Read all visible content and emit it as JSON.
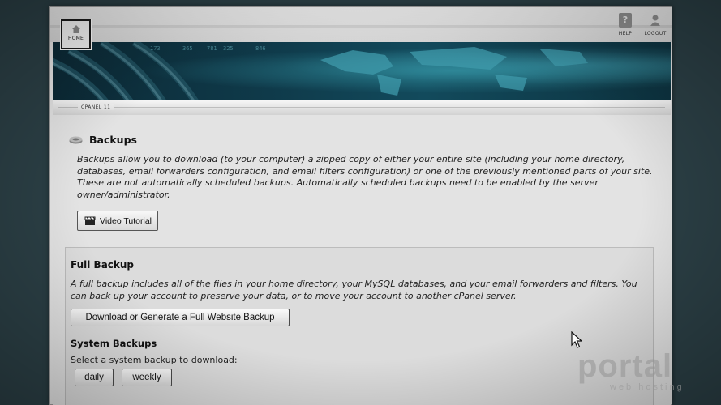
{
  "header": {
    "home_label": "HOME",
    "help_label": "HELP",
    "logout_label": "LOGOUT"
  },
  "breadcrumb": {
    "label": "CPANEL 11"
  },
  "page": {
    "title": "Backups",
    "intro": "Backups allow you to download (to your computer) a zipped copy of either your entire site (including your home directory, databases, email forwarders configuration, and email filters configuration) or one of the previously mentioned parts of your site. These are not automatically scheduled backups. Automatically scheduled backups need to be enabled by the server owner/administrator.",
    "video_button": "Video Tutorial"
  },
  "full_backup": {
    "title": "Full Backup",
    "description": "A full backup includes all of the files in your home directory, your MySQL databases, and your email forwarders and filters. You can back up your account to preserve your data, or to move your account to another cPanel server.",
    "button": "Download or Generate a Full Website Backup"
  },
  "system_backups": {
    "title": "System Backups",
    "select_label": "Select a system backup to download:",
    "buttons": [
      "daily",
      "weekly"
    ]
  },
  "watermark": {
    "brand": "portal",
    "tagline": "web hosting"
  },
  "icons": {
    "home": "home-icon",
    "help": "help-icon",
    "logout": "logout-icon",
    "backups": "backups-icon",
    "video": "clapperboard-icon"
  }
}
